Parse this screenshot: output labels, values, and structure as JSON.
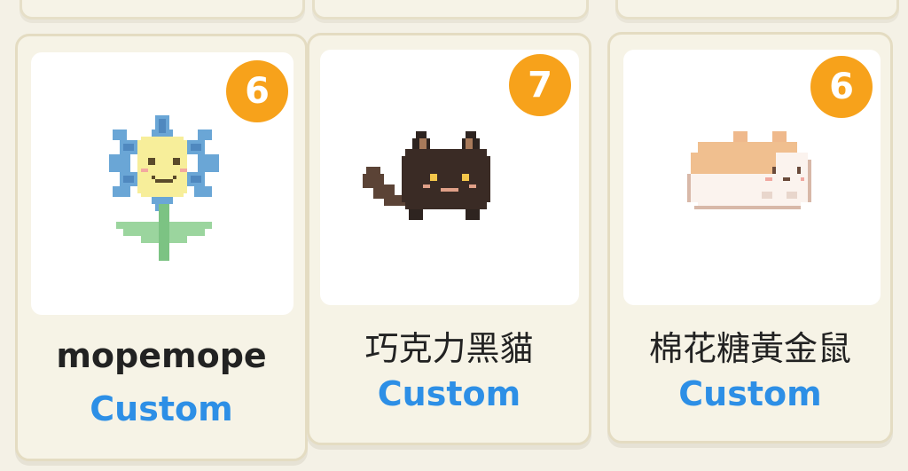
{
  "cards": [
    {
      "badge": "6",
      "name": "mopemope",
      "tag": "Custom",
      "art_icon": "pixel-flower-icon"
    },
    {
      "badge": "7",
      "name": "巧克力黑貓",
      "tag": "Custom",
      "art_icon": "pixel-black-cat-icon"
    },
    {
      "badge": "6",
      "name": "棉花糖黃金鼠",
      "tag": "Custom",
      "art_icon": "pixel-hamster-icon"
    }
  ],
  "colors": {
    "badge": "#f7a21b",
    "tag": "#2d8fe6",
    "card_bg": "#f6f3e6"
  }
}
